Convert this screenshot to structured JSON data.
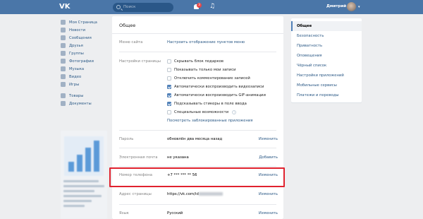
{
  "header": {
    "search_placeholder": "Поиск",
    "notification_count": "3",
    "user_name": "Дмитрий"
  },
  "left_nav": [
    {
      "label": "Моя Страница",
      "icon": "home-icon"
    },
    {
      "label": "Новости",
      "icon": "news-icon"
    },
    {
      "label": "Сообщения",
      "icon": "messages-icon"
    },
    {
      "label": "Друзья",
      "icon": "friends-icon"
    },
    {
      "label": "Группы",
      "icon": "groups-icon"
    },
    {
      "label": "Фотографии",
      "icon": "photos-icon"
    },
    {
      "label": "Музыка",
      "icon": "music-icon"
    },
    {
      "label": "Видео",
      "icon": "video-icon"
    },
    {
      "label": "Игры",
      "icon": "games-icon"
    },
    {
      "label": "Товары",
      "icon": "goods-icon"
    },
    {
      "label": "Документы",
      "icon": "documents-icon"
    }
  ],
  "main": {
    "title": "Общее",
    "site_menu": {
      "label": "Меню сайта",
      "link": "Настроить отображение пунктов меню"
    },
    "page_settings": {
      "label": "Настройки страницы",
      "options": [
        {
          "label": "Скрывать блок подарков",
          "checked": false
        },
        {
          "label": "Показывать только мои записи",
          "checked": false
        },
        {
          "label": "Отключить комментирование записей",
          "checked": false
        },
        {
          "label": "Автоматически воспроизводить видеозаписи",
          "checked": true
        },
        {
          "label": "Автоматически воспроизводить GIF-анимации",
          "checked": true
        },
        {
          "label": "Подсказывать стикеры в поле ввода",
          "checked": true
        },
        {
          "label": "Специальные возможности",
          "checked": false
        }
      ],
      "blocked_apps_link": "Посмотреть заблокированные приложения"
    },
    "password": {
      "label": "Пароль",
      "value": "обновлён два месяца назад",
      "action": "Изменить"
    },
    "email": {
      "label": "Электронная почта",
      "value": "не указана",
      "action": "Добавить"
    },
    "phone": {
      "label": "Номер телефона",
      "value": "+7 *** *** ** 56",
      "action": "Изменить"
    },
    "address": {
      "label": "Адрес страницы",
      "value": "https://vk.com/id",
      "action": "Изменить"
    },
    "language": {
      "label": "Язык",
      "value": "Русский",
      "action": "Изменить"
    }
  },
  "right_nav": [
    {
      "label": "Общее",
      "active": true
    },
    {
      "label": "Безопасность",
      "active": false
    },
    {
      "label": "Приватность",
      "active": false
    },
    {
      "label": "Оповещения",
      "active": false
    },
    {
      "label": "Чёрный список",
      "active": false
    },
    {
      "label": "Настройки приложений",
      "active": false
    },
    {
      "label": "Мобильные сервисы",
      "active": false
    },
    {
      "label": "Платежи и переводы",
      "active": false
    }
  ],
  "colors": {
    "header_bg": "#4a76a8",
    "link": "#2a5885",
    "highlight": "#e0222f"
  }
}
